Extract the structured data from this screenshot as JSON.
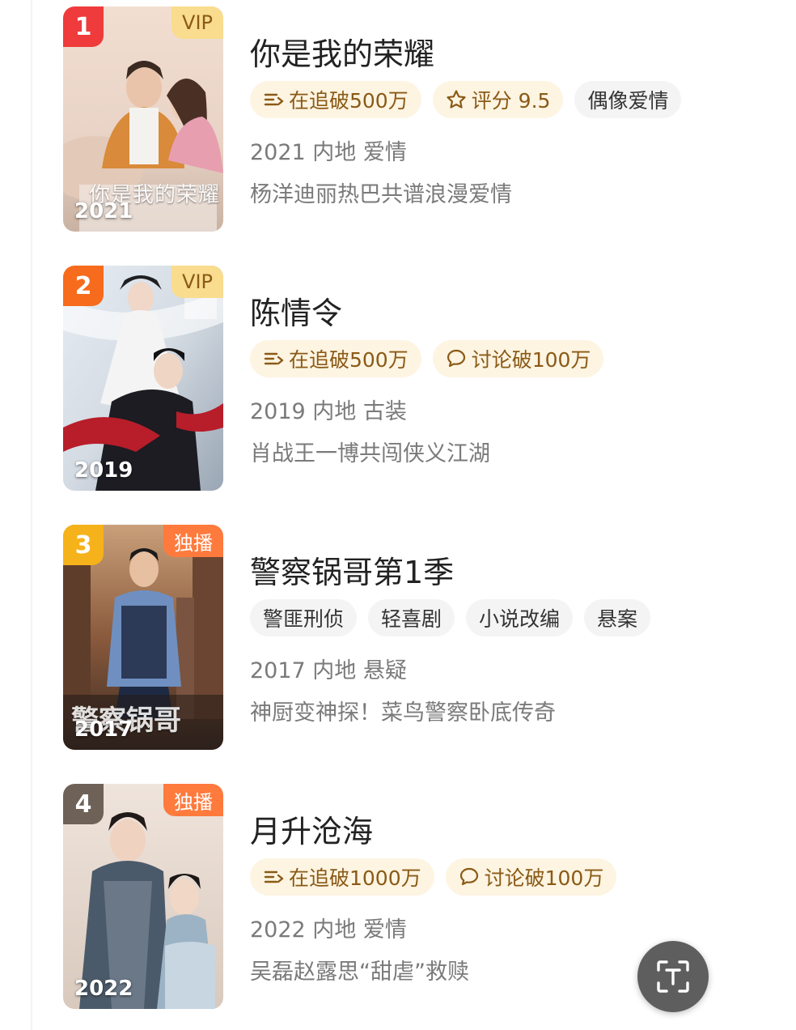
{
  "colors": {
    "rank_1": "#ef3b3b",
    "rank_2": "#f76b1c",
    "rank_3": "#f5b21a",
    "rank_4": "#6e6258",
    "hot_tag_bg": "#fdf4e2",
    "hot_tag_text": "#8a5a16"
  },
  "items": [
    {
      "rank": "1",
      "badge": "VIP",
      "badge_type": "vip",
      "year_overlay": "2021",
      "poster_text": "你是我的荣耀",
      "title": "你是我的荣耀",
      "tags": [
        {
          "icon": "following-list-icon",
          "label": "在追破500万",
          "style": "hot"
        },
        {
          "icon": "star-icon",
          "label": "评分 9.5",
          "style": "hot"
        },
        {
          "icon": "",
          "label": "偶像爱情",
          "style": "plain"
        }
      ],
      "meta": "2021 内地 爱情",
      "desc": "杨洋迪丽热巴共谱浪漫爱情"
    },
    {
      "rank": "2",
      "badge": "VIP",
      "badge_type": "vip",
      "year_overlay": "2019",
      "poster_text": "",
      "title": "陈情令",
      "tags": [
        {
          "icon": "following-list-icon",
          "label": "在追破500万",
          "style": "hot"
        },
        {
          "icon": "chat-bubble-icon",
          "label": "讨论破100万",
          "style": "hot"
        }
      ],
      "meta": "2019 内地 古装",
      "desc": "肖战王一博共闯侠义江湖"
    },
    {
      "rank": "3",
      "badge": "独播",
      "badge_type": "excl",
      "year_overlay": "2017",
      "poster_text": "警察锅哥",
      "title": "警察锅哥第1季",
      "tags": [
        {
          "icon": "",
          "label": "警匪刑侦",
          "style": "plain"
        },
        {
          "icon": "",
          "label": "轻喜剧",
          "style": "plain"
        },
        {
          "icon": "",
          "label": "小说改编",
          "style": "plain"
        },
        {
          "icon": "",
          "label": "悬案",
          "style": "plain"
        }
      ],
      "meta": "2017 内地 悬疑",
      "desc": "神厨变神探！菜鸟警察卧底传奇"
    },
    {
      "rank": "4",
      "badge": "独播",
      "badge_type": "excl",
      "year_overlay": "2022",
      "poster_text": "",
      "title": "月升沧海",
      "tags": [
        {
          "icon": "following-list-icon",
          "label": "在追破1000万",
          "style": "hot"
        },
        {
          "icon": "chat-bubble-icon",
          "label": "讨论破100万",
          "style": "hot"
        }
      ],
      "meta": "2022 内地 爱情",
      "desc": "吴磊赵露思“甜虐”救赎"
    }
  ],
  "floating_button": {
    "icon": "text-scan-icon"
  }
}
